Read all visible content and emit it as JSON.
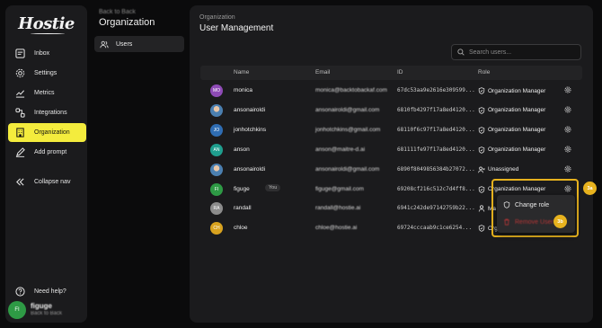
{
  "brand": {
    "logo_text": "Hostie"
  },
  "nav": {
    "items": [
      {
        "label": "Inbox",
        "icon": "inbox-icon"
      },
      {
        "label": "Settings",
        "icon": "settings-icon"
      },
      {
        "label": "Metrics",
        "icon": "metrics-icon"
      },
      {
        "label": "Integrations",
        "icon": "integrations-icon"
      },
      {
        "label": "Organization",
        "icon": "building-icon",
        "active": true
      },
      {
        "label": "Add prompt",
        "icon": "pencil-icon"
      }
    ],
    "collapse_label": "Collapse nav",
    "help_label": "Need help?",
    "user": {
      "initials": "FI",
      "name": "figuge",
      "subtitle": "Back to Back"
    }
  },
  "subnav": {
    "back_label": "Back to Back",
    "title": "Organization",
    "items": [
      {
        "label": "Users",
        "icon": "users-icon",
        "active": true
      }
    ]
  },
  "main": {
    "org_label": "Organization",
    "title": "User Management",
    "search": {
      "placeholder": "Search users..."
    },
    "table": {
      "columns": [
        "Name",
        "Email",
        "ID",
        "Role"
      ],
      "rows": [
        {
          "initials": "MO",
          "avatar_color": "#8e4bb6",
          "name": "monica",
          "you": "",
          "email": "monica@backtobackaf.com",
          "id": "67dc53aa9e2616e309599...",
          "role": "Organization Manager",
          "role_icon": "shield-icon"
        },
        {
          "initials": "",
          "avatar_color": "photo",
          "name": "ansonairoldi",
          "you": "",
          "email": "ansonairoldi@gmail.com",
          "id": "6810fb4297f17a8ed4120...",
          "role": "Organization Manager",
          "role_icon": "shield-icon"
        },
        {
          "initials": "JO",
          "avatar_color": "#2f6db3",
          "name": "jonhotchkins",
          "you": "",
          "email": "jonhotchkins@gmail.com",
          "id": "68110f6c97f17a8ed4120...",
          "role": "Organization Manager",
          "role_icon": "shield-icon"
        },
        {
          "initials": "AN",
          "avatar_color": "#1f9e8e",
          "name": "anson",
          "you": "",
          "email": "anson@maitre-d.ai",
          "id": "681111fe97f17a8ed4120...",
          "role": "Organization Manager",
          "role_icon": "shield-icon"
        },
        {
          "initials": "",
          "avatar_color": "photo",
          "name": "ansonairoldi",
          "you": "",
          "email": "ansonairoldi@gmail.com",
          "id": "6890f8049856384b27072...",
          "role": "Unassigned",
          "role_icon": "user-x-icon"
        },
        {
          "initials": "FI",
          "avatar_color": "#2e9a45",
          "name": "figuge",
          "you": "You",
          "email": "figuge@gmail.com",
          "id": "69208cf216c512c7d4ff8...",
          "role": "Organization Manager",
          "role_icon": "shield-icon"
        },
        {
          "initials": "RA",
          "avatar_color": "#8c8c8c",
          "name": "randall",
          "you": "",
          "email": "randall@hostie.ai",
          "id": "6941c242de97142759b22...",
          "role": "Ma",
          "role_icon": "user-icon"
        },
        {
          "initials": "CH",
          "avatar_color": "#d8a21f",
          "name": "chloe",
          "you": "",
          "email": "chloe@hostie.ai",
          "id": "69724cccaab9c1ce6254...",
          "role": "Org",
          "role_icon": "shield-icon"
        }
      ]
    },
    "row_menu": {
      "change_role_label": "Change role",
      "remove_user_label": "Remove User"
    },
    "annotations": {
      "badge_gear": "3a",
      "badge_remove": "3b"
    }
  },
  "colors": {
    "accent": "#f4ec3d",
    "highlight": "#e7b21e",
    "danger": "#b53636"
  }
}
